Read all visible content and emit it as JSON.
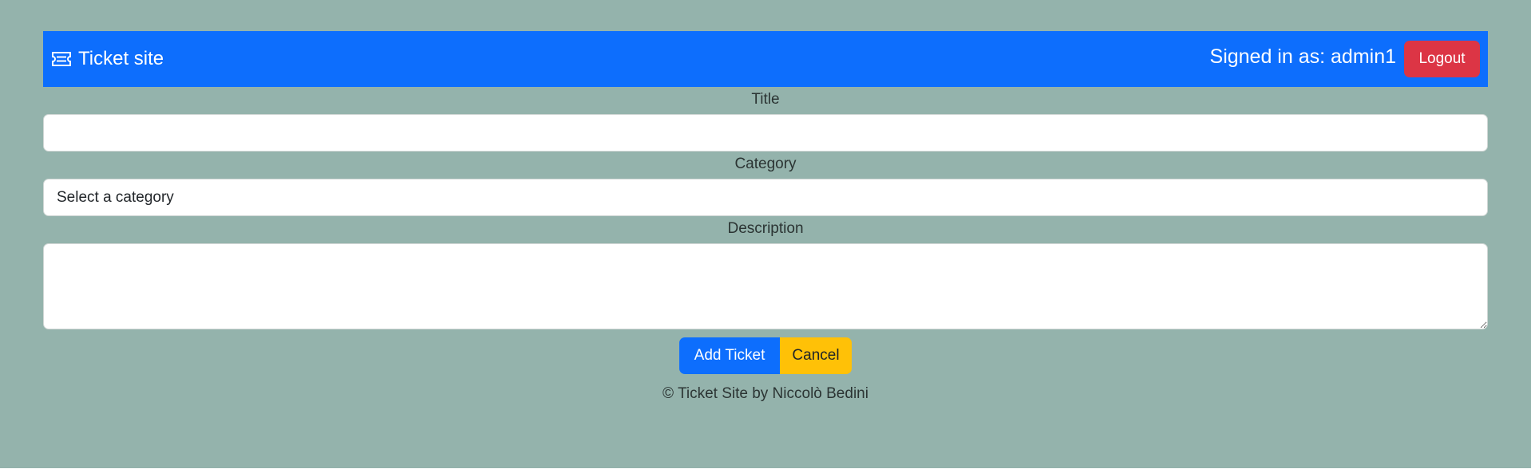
{
  "navbar": {
    "brand_icon": "ticket-icon",
    "brand_text": "Ticket site",
    "signed_in_text": "Signed in as: admin1",
    "logout_label": "Logout"
  },
  "form": {
    "title_label": "Title",
    "title_value": "",
    "category_label": "Category",
    "category_selected": "Select a category",
    "description_label": "Description",
    "description_value": "",
    "add_label": "Add Ticket",
    "cancel_label": "Cancel"
  },
  "footer": {
    "text": "© Ticket Site by Niccolò Bedini"
  },
  "colors": {
    "background": "#94b3ac",
    "primary": "#0d6efd",
    "danger": "#dc3545",
    "warning": "#ffc107"
  }
}
